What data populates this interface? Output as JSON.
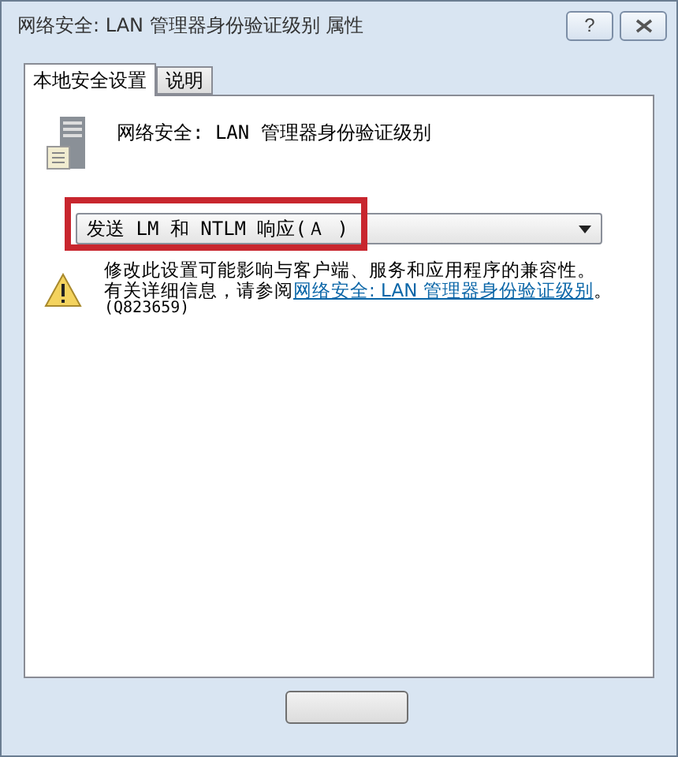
{
  "window": {
    "title": "网络安全: LAN 管理器身份验证级别 属性",
    "help_button": "?"
  },
  "tabs": [
    {
      "label": "本地安全设置",
      "selected": true
    },
    {
      "label": "说明",
      "selected": false
    }
  ],
  "policy": {
    "name": "网络安全: LAN 管理器身份验证级别"
  },
  "dropdown": {
    "value": "发送 LM 和 NTLM 响应(Ａ )",
    "highlighted": true
  },
  "warning": {
    "line_1": "修改此设置可能影响与客户端、服务和应用程序的兼容性。",
    "line_2_prefix": "有关详细信息，请参阅",
    "link": "网络安全: LAN 管理器身份验证级别",
    "line_2_suffix": "。",
    "line_3": "(Q823659)"
  }
}
